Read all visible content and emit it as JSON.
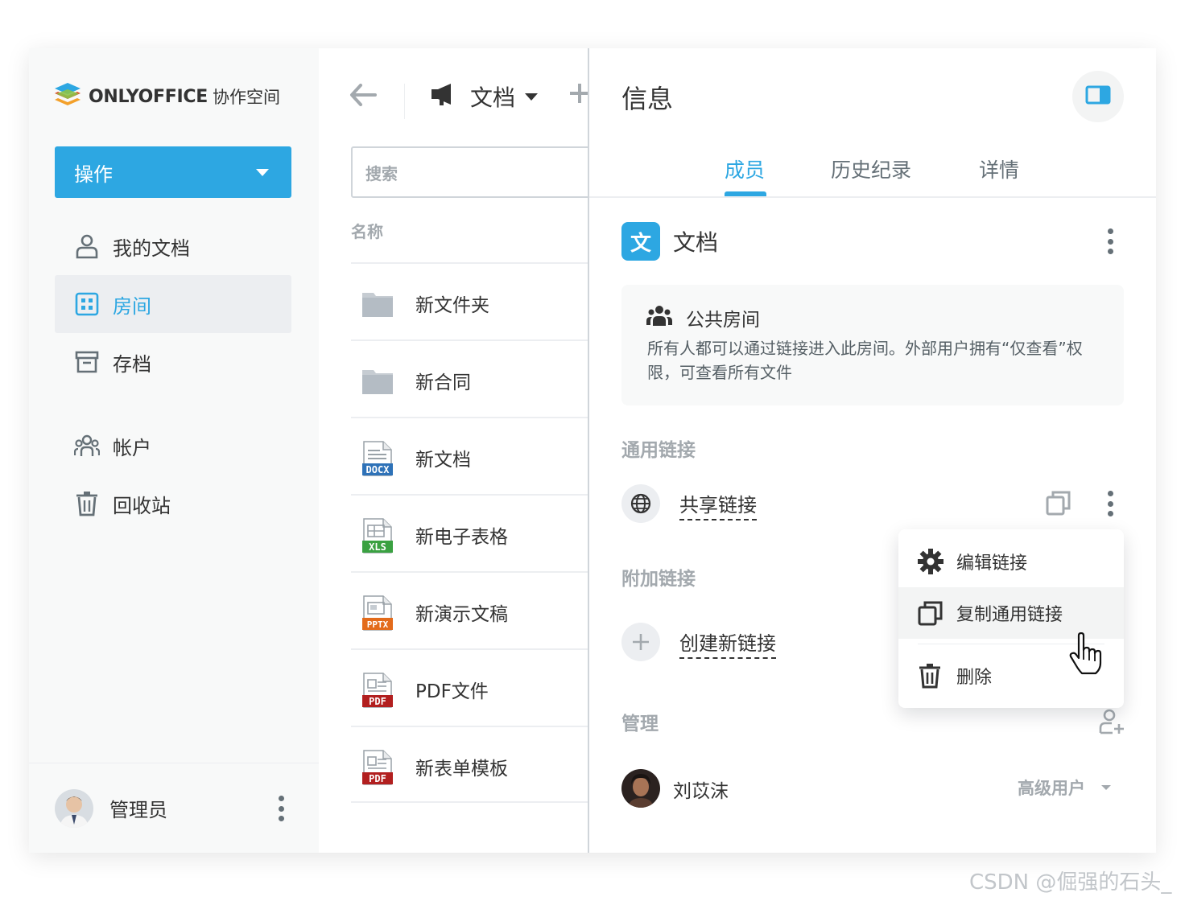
{
  "app": {
    "logo_text": "ONLYOFFICE",
    "logo_sub": "协作空间",
    "accent": "#2da7e2"
  },
  "sidebar": {
    "action_label": "操作",
    "items": [
      {
        "label": "我的文档",
        "icon": "user-icon"
      },
      {
        "label": "房间",
        "icon": "rooms-icon",
        "active": true
      },
      {
        "label": "存档",
        "icon": "archive-icon"
      },
      {
        "label": "帐户",
        "icon": "accounts-icon"
      },
      {
        "label": "回收站",
        "icon": "trash-icon"
      }
    ],
    "user_name": "管理员"
  },
  "middle": {
    "title": "文档",
    "search_placeholder": "搜索",
    "column_name": "名称",
    "files": [
      {
        "name": "新文件夹",
        "type": "folder"
      },
      {
        "name": "新合同",
        "type": "folder"
      },
      {
        "name": "新文档",
        "type": "DOCX",
        "color": "#2e72b8"
      },
      {
        "name": "新电子表格",
        "type": "XLS",
        "color": "#3aa141"
      },
      {
        "name": "新演示文稿",
        "type": "PPTX",
        "color": "#e36b1b"
      },
      {
        "name": "PDF文件",
        "type": "PDF",
        "color": "#b21f1f"
      },
      {
        "name": "新表单模板",
        "type": "PDF",
        "color": "#b21f1f"
      }
    ]
  },
  "info": {
    "title": "信息",
    "tabs": [
      "成员",
      "历史纪录",
      "详情"
    ],
    "room_badge": "文",
    "room_name": "文档",
    "public_room_title": "公共房间",
    "public_room_desc": "所有人都可以通过链接进入此房间。外部用户拥有“仅查看”权限，可查看所有文件",
    "general_links_label": "通用链接",
    "share_link_label": "共享链接",
    "additional_links_label": "附加链接",
    "create_link_label": "创建新链接",
    "manage_label": "管理",
    "member_name": "刘苡沫",
    "member_role": "高级用户"
  },
  "context_menu": {
    "items": [
      {
        "label": "编辑链接",
        "icon": "gear-icon"
      },
      {
        "label": "复制通用链接",
        "icon": "copy-icon",
        "hover": true
      },
      {
        "label": "删除",
        "icon": "trash-icon"
      }
    ]
  },
  "watermark": "CSDN @倔强的石头_"
}
